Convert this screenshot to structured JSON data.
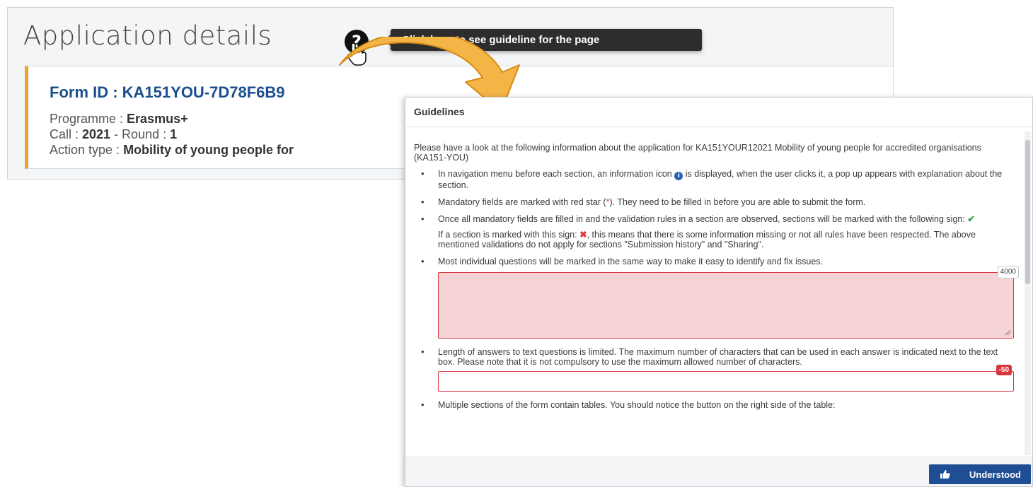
{
  "header": {
    "title": "Application details",
    "tooltip": "Click here to see guideline for the page"
  },
  "form": {
    "id_label": "Form ID : KA151YOU-7D78F6B9",
    "programme_label": "Programme : ",
    "programme_value": "Erasmus+",
    "call_label": "Call : ",
    "call_value": "2021",
    "round_label": " - Round : ",
    "round_value": "1",
    "action_label": "Action type : ",
    "action_value": "Mobility of young people for"
  },
  "guidelines": {
    "title": "Guidelines",
    "intro": "Please have a look at the following information about the application for KA151YOUR12021 Mobility of young people for accredited organisations (KA151-YOU)",
    "item1_a": "In navigation menu before each section, an information icon ",
    "item1_b": " is displayed, when the user clicks it, a pop up appears with explanation about the section.",
    "item2_a": "Mandatory fields are marked with red star (",
    "item2_star": "*",
    "item2_b": "). They need to be filled in before you are able to submit the form.",
    "item3_a": "Once all mandatory fields are filled in and the validation rules in a section are observed, sections will be marked with the following sign: ",
    "item3_sub_a": "If a section is marked with this sign: ",
    "item3_sub_b": ", this means that there is some information missing or not all rules have been respected. The above mentioned validations do not apply for sections \"Submission history\" and \"Sharing\".",
    "item4": "Most individual questions will be marked in the same way to make it easy to identify and fix issues.",
    "textarea_counter": "4000",
    "item5": "Length of answers to text questions is limited. The maximum number of characters that can be used in each answer is indicated next to the text box. Please note that it is not compulsory to use the maximum allowed number of characters.",
    "input_counter": "-50",
    "item6": "Multiple sections of the form contain tables. You should notice the button on the right side of the table:",
    "understood_label": "Understood"
  },
  "icons": {
    "help": "question-circle-icon",
    "info": "info-icon",
    "check": "check-icon",
    "cross": "cross-icon",
    "thumbs_up": "thumbs-up-icon",
    "cursor": "hand-pointer-icon"
  },
  "colors": {
    "form_id": "#1b4f8f",
    "accent_orange": "#f0a12e",
    "error_red": "#d9363e",
    "success_green": "#2e9c3e",
    "primary_button": "#1f4e93"
  }
}
